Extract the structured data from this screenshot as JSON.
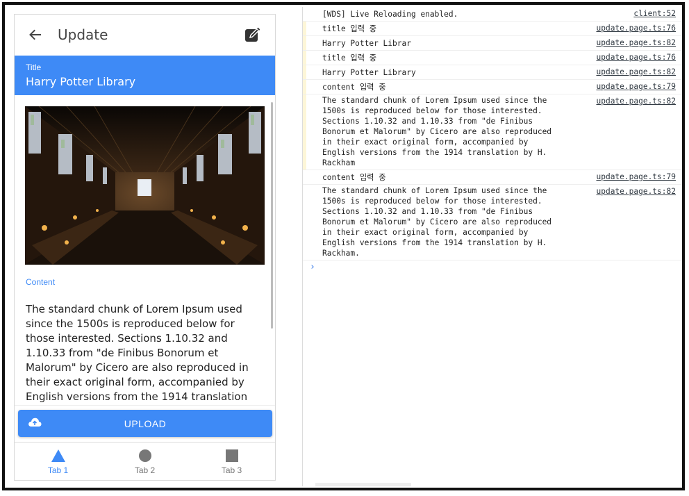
{
  "app": {
    "toolbar": {
      "title": "Update",
      "back_icon": "arrow-back-icon",
      "edit_icon": "edit-icon"
    },
    "title_field": {
      "label": "Title",
      "value": "Harry Potter Library"
    },
    "content_field": {
      "label": "Content",
      "value": "The standard chunk of Lorem Ipsum used since the 1500s is reproduced below for those interested. Sections 1.10.32 and 1.10.33 from \"de Finibus Bonorum et Malorum\" by Cicero are also reproduced in their exact original form, accompanied by English versions from the 1914 translation by H. Rackham."
    },
    "upload_button": {
      "label": "UPLOAD",
      "icon": "cloud-upload-icon"
    },
    "tabs": [
      {
        "label": "Tab 1",
        "icon": "triangle-icon",
        "active": true
      },
      {
        "label": "Tab 2",
        "icon": "circle-icon",
        "active": false
      },
      {
        "label": "Tab 3",
        "icon": "square-icon",
        "active": false
      }
    ],
    "colors": {
      "primary": "#3e8af6",
      "tab_inactive": "#777777"
    }
  },
  "console": {
    "logs": [
      {
        "message": "[WDS] Live Reloading enabled.",
        "source": "client:52",
        "highlight": false
      },
      {
        "message": "title 입력 중",
        "source": "update.page.ts:76",
        "highlight": true
      },
      {
        "message": "Harry Potter Librar",
        "source": "update.page.ts:82",
        "highlight": true
      },
      {
        "message": "title 입력 중",
        "source": "update.page.ts:76",
        "highlight": true
      },
      {
        "message": "Harry Potter Library",
        "source": "update.page.ts:82",
        "highlight": true
      },
      {
        "message": "content 입력 중",
        "source": "update.page.ts:79",
        "highlight": true
      },
      {
        "message": "The standard chunk of Lorem Ipsum used since the 1500s is reproduced below for those interested. Sections 1.10.32 and 1.10.33 from \"de Finibus Bonorum et Malorum\" by Cicero are also reproduced in their exact original form, accompanied by English versions from the 1914 translation by H. Rackham",
        "source": "update.page.ts:82",
        "highlight": true
      },
      {
        "message": "content 입력 중",
        "source": "update.page.ts:79",
        "highlight": false
      },
      {
        "message": "The standard chunk of Lorem Ipsum used since the 1500s is reproduced below for those interested. Sections 1.10.32 and 1.10.33 from \"de Finibus Bonorum et Malorum\" by Cicero are also reproduced in their exact original form, accompanied by English versions from the 1914 translation by H. Rackham.",
        "source": "update.page.ts:82",
        "highlight": false
      }
    ],
    "prompt_symbol": "›",
    "colors": {
      "prompt": "#3b7de8",
      "highlight": "#fdf6d8"
    }
  }
}
